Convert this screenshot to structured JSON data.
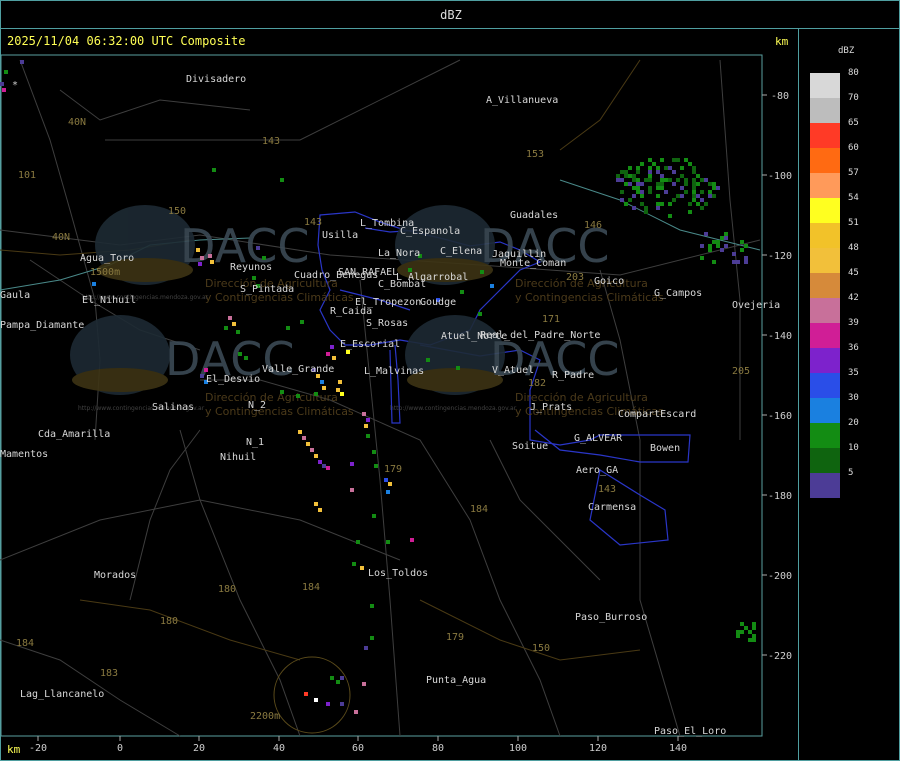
{
  "window": {
    "title": "dBZ"
  },
  "timestamp": "2025/11/04 06:32:00 UTC Composite",
  "units": {
    "y_label": "km",
    "x_label": "km"
  },
  "axes": {
    "x_ticks": [
      "-20",
      "0",
      "20",
      "40",
      "60",
      "80",
      "100",
      "120",
      "140"
    ],
    "y_ticks": [
      "-80",
      "-100",
      "-120",
      "-140",
      "-160",
      "-180",
      "-200",
      "-220"
    ]
  },
  "legend": {
    "title": "dBZ",
    "levels": [
      {
        "label": "80",
        "color": "#d8d8d8"
      },
      {
        "label": "70",
        "color": "#bdbdbd"
      },
      {
        "label": "65",
        "color": "#ff3a26"
      },
      {
        "label": "60",
        "color": "#ff6a12"
      },
      {
        "label": "57",
        "color": "#ff9a5a"
      },
      {
        "label": "54",
        "color": "#ffff20"
      },
      {
        "label": "51",
        "color": "#f2c229"
      },
      {
        "label": "48",
        "color": "#f2c03a"
      },
      {
        "label": "45",
        "color": "#d68a3a"
      },
      {
        "label": "42",
        "color": "#c8709a"
      },
      {
        "label": "39",
        "color": "#d01e96"
      },
      {
        "label": "36",
        "color": "#7d22cc"
      },
      {
        "label": "35",
        "color": "#2a4ee8"
      },
      {
        "label": "30",
        "color": "#1a80e0"
      },
      {
        "label": "20",
        "color": "#138c13"
      },
      {
        "label": "10",
        "color": "#0f640f"
      },
      {
        "label": "5",
        "color": "#4c3c96"
      }
    ]
  },
  "places": [
    "Divisadero",
    "A_Villanueva",
    "Guadales",
    "Agua_Toro",
    "Pampa_Diamante",
    "Reyunos",
    "El_Nihuil",
    "Salinas",
    "Cda_Amarilla",
    "Nihuil",
    "N_1",
    "N_2",
    "El_Desvio",
    "Valle_Grande",
    "L_Malvinas",
    "E_Escorial",
    "S_Rosas",
    "R_Caida",
    "S_Pintada",
    "Cuadro_Benegas",
    "SAN_RAFAEL",
    "El_Tropezon",
    "Goudge",
    "C_Bombal",
    "L_Algarrobal",
    "La_Nora",
    "C_Espanola",
    "Usilla",
    "L_Tombina",
    "C_Elena",
    "Jaquillin",
    "Real_del_Padre_Norte",
    "Atuel_Norte",
    "Monte_Coman",
    "Goico",
    "G_Campos",
    "Ovejeria",
    "V_Atuel",
    "R_Padre",
    "J_Prats",
    "CompartEscard",
    "G_ALVEAR",
    "Bowen",
    "Soitue",
    "Aero_GA",
    "Carmensa",
    "Los_Toldos",
    "Morados",
    "Paso_Burroso",
    "Punta_Agua",
    "Lag_Llancanelo",
    "Paso_El_Loro",
    "Mamentos",
    "Gaula"
  ],
  "roads": [
    "40N",
    "40N",
    "101",
    "143",
    "150",
    "143",
    "153",
    "146",
    "203",
    "171",
    "182",
    "179",
    "184",
    "184",
    "180",
    "180",
    "184",
    "183",
    "179",
    "150",
    "143",
    "205"
  ],
  "watermark": {
    "brand": "DACC",
    "line1": "Dirección de Agricultura",
    "line2": "y Contingencias Climáticas",
    "url": "http://www.contingencias.mendoza.gov.ar"
  },
  "colors": {
    "frame": "#4f9ea0",
    "province_boundary": "#2a36c8",
    "roads": "#5a4a1a",
    "timestamp": "#ffff55"
  }
}
